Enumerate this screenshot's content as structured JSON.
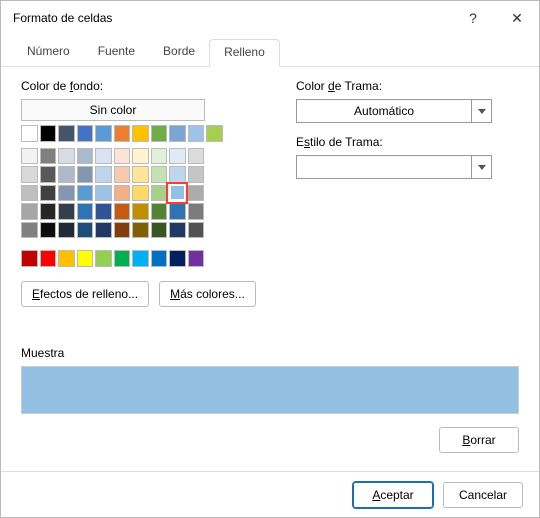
{
  "dialog": {
    "title": "Formato de celdas",
    "help": "?",
    "close": "✕"
  },
  "tabs": {
    "items": [
      {
        "label": "Número"
      },
      {
        "label": "Fuente"
      },
      {
        "label": "Borde"
      },
      {
        "label": "Relleno"
      }
    ],
    "active_index": 3
  },
  "left": {
    "bg_label_pre": "Color de ",
    "bg_label_u": "f",
    "bg_label_post": "ondo:",
    "no_color_label": "Sin color",
    "theme_colors_row": [
      "#ffffff",
      "#000000",
      "#44546a",
      "#4472c4",
      "#5b9bd5",
      "#ed7d31",
      "#ffc000",
      "#70ad47",
      "#7aa5d6",
      "#9dc3e6",
      "#a6cf4e"
    ],
    "shade_rows": [
      [
        "#f2f2f2",
        "#7f7f7f",
        "#d6dce4",
        "#acb9ca",
        "#d9e1f2",
        "#fbe4d5",
        "#fff2cc",
        "#e2efd9",
        "#deeaf6",
        "#dbdbdb"
      ],
      [
        "#d9d9d9",
        "#595959",
        "#adb9ca",
        "#8496b0",
        "#bdd6ee",
        "#f7caac",
        "#ffe598",
        "#c5e0b3",
        "#bdd6ee",
        "#c5c5c5"
      ],
      [
        "#bfbfbf",
        "#404040",
        "#8496b0",
        "#5b9bd5",
        "#9cc2e5",
        "#f4b083",
        "#ffd965",
        "#a8d08d",
        "#9cc2e5",
        "#acacac"
      ],
      [
        "#a6a6a6",
        "#262626",
        "#333f4f",
        "#2e74b5",
        "#2f5496",
        "#c55a11",
        "#bf8f00",
        "#548235",
        "#2e74b5",
        "#7b7b7b"
      ],
      [
        "#808080",
        "#0c0c0c",
        "#222a35",
        "#1f4e79",
        "#1f3864",
        "#833c0b",
        "#806000",
        "#385623",
        "#1f3864",
        "#525252"
      ]
    ],
    "selected_swatch": {
      "row": 2,
      "col": 8,
      "color": "#93bfe3"
    },
    "standard_colors": [
      "#c00000",
      "#ff0000",
      "#ffc000",
      "#ffff00",
      "#92d050",
      "#00b050",
      "#00b0f0",
      "#0070c0",
      "#002060",
      "#7030a0"
    ],
    "fill_effects_label_u": "E",
    "fill_effects_label_post": "fectos de relleno...",
    "more_colors_label_u": "M",
    "more_colors_label_post": "ás colores..."
  },
  "right": {
    "trama_color_label_pre": "Color ",
    "trama_color_label_u": "d",
    "trama_color_label_post": "e Trama:",
    "trama_color_value": "Automático",
    "trama_style_label_pre": "E",
    "trama_style_label_u": "s",
    "trama_style_label_post": "tilo de Trama:",
    "trama_style_value": ""
  },
  "sample": {
    "label": "Muestra",
    "fill": "#93bfe3"
  },
  "buttons": {
    "clear_u": "B",
    "clear_post": "orrar",
    "ok_u": "A",
    "ok_post": "ceptar",
    "cancel": "Cancelar"
  }
}
